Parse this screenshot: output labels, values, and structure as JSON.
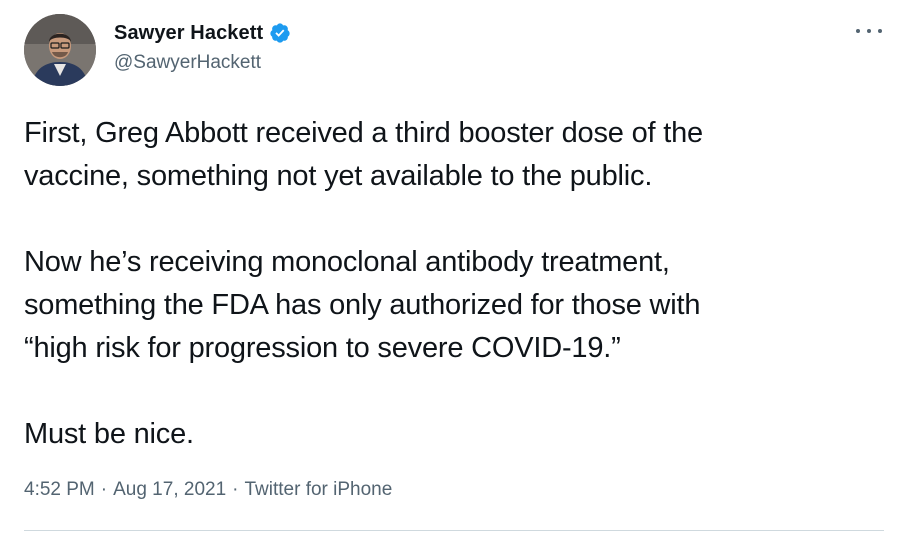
{
  "author": {
    "display_name": "Sawyer Hackett",
    "handle": "@SawyerHackett",
    "verified": true
  },
  "tweet": {
    "lines_para1": [
      "First, Greg Abbott received a third booster dose of the",
      "vaccine, something not yet available to the public."
    ],
    "lines_para2": [
      "Now he’s receiving monoclonal antibody treatment,",
      "something the FDA has only authorized for those with",
      "“high risk for progression to severe COVID-19.”"
    ],
    "lines_para3": [
      "Must be nice."
    ]
  },
  "meta": {
    "time": "4:52 PM",
    "date": "Aug 17, 2021",
    "source": "Twitter for iPhone",
    "separator": "·"
  },
  "icons": {
    "more": "more-options-icon",
    "verified": "verified-badge-icon"
  },
  "colors": {
    "text": "#0f1419",
    "secondary": "#536471",
    "verified_blue": "#1d9bf0",
    "divider": "#cfd9de"
  }
}
